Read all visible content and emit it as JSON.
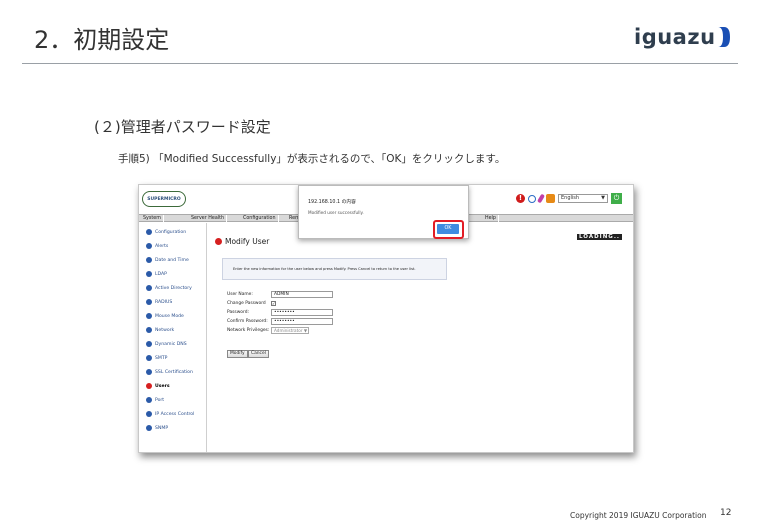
{
  "slide": {
    "title": "2．初期設定",
    "logo_text": "iguazu",
    "section_title": "(２)管理者パスワード設定",
    "step_text": "手順5) 「Modified Successfully」が表示されるので、「OK」をクリックします。",
    "copyright": "Copyright 2019 IGUAZU Corporation",
    "page_number": "12"
  },
  "screenshot": {
    "brand": "SUPERMICRO",
    "language": "English",
    "menu": [
      "System",
      "Server Health",
      "Configuration",
      "Rem",
      "Help"
    ],
    "sidebar": [
      "Configuration",
      "Alerts",
      "Date and Time",
      "LDAP",
      "Active Directory",
      "RADIUS",
      "Mouse Mode",
      "Network",
      "Dynamic DNS",
      "SMTP",
      "SSL Certification",
      "Users",
      "Port",
      "IP Access Control",
      "SNMP"
    ],
    "active_sidebar_item": "Users",
    "page_heading": "Modify User",
    "loading_text": "LOADING..",
    "info_text": "Enter the new information for the user below and press Modify. Press Cancel to return to the user list.",
    "form": {
      "user_name_label": "User Name:",
      "user_name_value": "ADMIN",
      "change_password_label": "Change Password",
      "change_password_checked": true,
      "password_label": "Password:",
      "password_value": "••••••••",
      "confirm_password_label": "Confirm Password:",
      "confirm_password_value": "••••••••",
      "network_privileges_label": "Network Privileges:",
      "network_privileges_value": "Administrator"
    },
    "modify_button": "Modify",
    "cancel_button": "Cancel",
    "dialog": {
      "title": "192.168.10.1 の内容",
      "message": "Modified user successfully.",
      "ok_label": "OK"
    }
  },
  "colors": {
    "highlight": "#e21d26",
    "ok_button": "#3f8be0",
    "logo": "#2f3e4e",
    "logo_accent": "#1a4fb4"
  }
}
